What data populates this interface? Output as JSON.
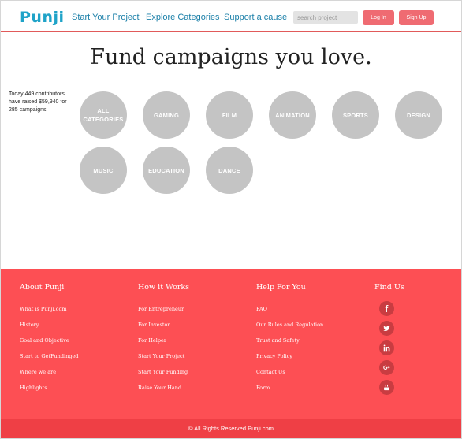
{
  "header": {
    "logo": "Punji",
    "nav": {
      "start_project": "Start Your Project",
      "explore": "Explore Categories",
      "support": "Support a cause"
    },
    "search_placeholder": "search project",
    "login_label": "Log In",
    "signup_label": "Sign Up"
  },
  "main": {
    "title": "Fund campaigns you love.",
    "stats": "Today 449 contributors have raised $59,940 for 285 campaigns.",
    "categories": [
      "ALL CATEGORIES",
      "GAMING",
      "FILM",
      "ANIMATION",
      "SPORTS",
      "DESIGN",
      "MUSIC",
      "EDUCATION",
      "DANCE"
    ]
  },
  "footer": {
    "about": {
      "heading": "About Punji",
      "links": [
        "What is Punji.com",
        "History",
        "Goal and Objective",
        "Start to GetFundinged",
        "Where we are",
        "Highlights"
      ]
    },
    "how": {
      "heading": "How it Works",
      "links": [
        "For Entrepreneur",
        "For Investor",
        "For Helper",
        "Start Your Project",
        "Start Your Funding",
        "Raise Your Hand"
      ]
    },
    "help": {
      "heading": "Help For You",
      "links": [
        "FAQ",
        "Our Rules and Regulation",
        "Trust and Safety",
        "Privacy Policy",
        "Contact Us",
        "Form"
      ]
    },
    "find": {
      "heading": "Find Us",
      "social": [
        "facebook-icon",
        "twitter-icon",
        "linkedin-icon",
        "google-plus-icon",
        "youtube-icon"
      ]
    },
    "copyright": "© All Rights Reserved Punji.com"
  },
  "colors": {
    "brand": "#1fa3c8",
    "accent": "#fd4f54",
    "button": "#ef6b72",
    "category": "#c4c4c4"
  }
}
